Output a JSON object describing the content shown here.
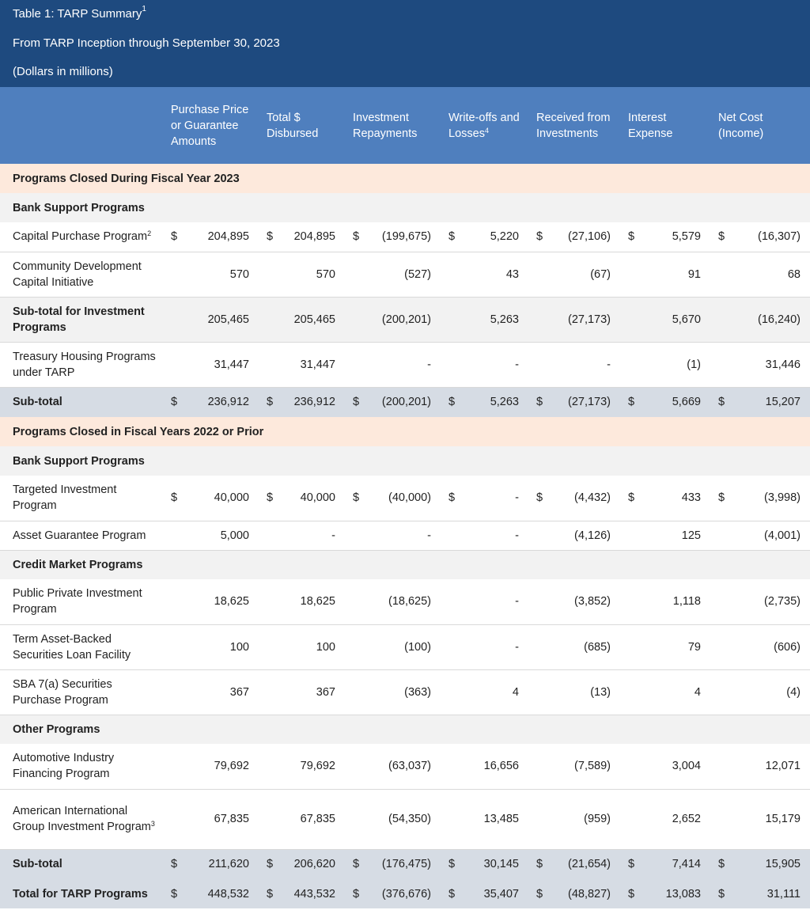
{
  "title": {
    "line1": "Table 1: TARP Summary",
    "line1_sup": "1",
    "line2": "From TARP Inception through September 30, 2023",
    "line3": "(Dollars in millions)"
  },
  "columns": [
    {
      "label": "Purchase Price or Guarantee Amounts",
      "sup": ""
    },
    {
      "label": "Total $ Disbursed",
      "sup": ""
    },
    {
      "label": "Investment Repayments",
      "sup": ""
    },
    {
      "label": "Write-offs and Losses",
      "sup": "4"
    },
    {
      "label": "Received from Investments",
      "sup": ""
    },
    {
      "label": "Interest Expense",
      "sup": ""
    },
    {
      "label": "Net Cost (Income)",
      "sup": ""
    }
  ],
  "rows": [
    {
      "type": "section",
      "label": "Programs Closed During Fiscal Year 2023"
    },
    {
      "type": "group",
      "label": "Bank Support Programs"
    },
    {
      "type": "data",
      "label": "Capital Purchase Program",
      "sup": "2",
      "dollar": true,
      "values": [
        "204,895",
        "204,895",
        "(199,675)",
        "5,220",
        "(27,106)",
        "5,579",
        "(16,307)"
      ]
    },
    {
      "type": "data",
      "label": "Community Development Capital Initiative",
      "sup": "",
      "dollar": false,
      "values": [
        "570",
        "570",
        "(527)",
        "43",
        "(67)",
        "91",
        "68"
      ]
    },
    {
      "type": "subinv",
      "label": "Sub-total for Investment Programs",
      "sup": "",
      "dollar": false,
      "values": [
        "205,465",
        "205,465",
        "(200,201)",
        "5,263",
        "(27,173)",
        "5,670",
        "(16,240)"
      ]
    },
    {
      "type": "data",
      "label": "Treasury Housing Programs under TARP",
      "sup": "",
      "dollar": false,
      "values": [
        "31,447",
        "31,447",
        "-",
        "-",
        "-",
        "(1)",
        "31,446"
      ]
    },
    {
      "type": "subtotal",
      "label": "Sub-total",
      "sup": "",
      "dollar": true,
      "values": [
        "236,912",
        "236,912",
        "(200,201)",
        "5,263",
        "(27,173)",
        "5,669",
        "15,207"
      ]
    },
    {
      "type": "section",
      "label": "Programs Closed in Fiscal Years 2022 or Prior"
    },
    {
      "type": "group",
      "label": "Bank Support Programs"
    },
    {
      "type": "data",
      "label": "Targeted Investment Program",
      "sup": "",
      "dollar": true,
      "values": [
        "40,000",
        "40,000",
        "(40,000)",
        "-",
        "(4,432)",
        "433",
        "(3,998)"
      ]
    },
    {
      "type": "data",
      "label": "Asset Guarantee Program",
      "sup": "",
      "dollar": false,
      "values": [
        "5,000",
        "-",
        "-",
        "-",
        "(4,126)",
        "125",
        "(4,001)"
      ]
    },
    {
      "type": "group",
      "label": "Credit Market Programs"
    },
    {
      "type": "data",
      "label": "Public Private Investment Program",
      "sup": "",
      "dollar": false,
      "values": [
        "18,625",
        "18,625",
        "(18,625)",
        "-",
        "(3,852)",
        "1,118",
        "(2,735)"
      ]
    },
    {
      "type": "data",
      "label": "Term Asset-Backed Securities Loan Facility",
      "sup": "",
      "dollar": false,
      "values": [
        "100",
        "100",
        "(100)",
        "-",
        "(685)",
        "79",
        "(606)"
      ]
    },
    {
      "type": "data",
      "label": "SBA 7(a) Securities Purchase Program",
      "sup": "",
      "dollar": false,
      "values": [
        "367",
        "367",
        "(363)",
        "4",
        "(13)",
        "4",
        "(4)"
      ]
    },
    {
      "type": "group",
      "label": "Other Programs"
    },
    {
      "type": "data",
      "label": "Automotive Industry Financing Program",
      "sup": "",
      "dollar": false,
      "values": [
        "79,692",
        "79,692",
        "(63,037)",
        "16,656",
        "(7,589)",
        "3,004",
        "12,071"
      ]
    },
    {
      "type": "data",
      "label": "American International Group Investment Program",
      "sup": "3",
      "dollar": false,
      "values": [
        "67,835",
        "67,835",
        "(54,350)",
        "13,485",
        "(959)",
        "2,652",
        "15,179"
      ]
    },
    {
      "type": "subtotal",
      "label": "Sub-total",
      "sup": "",
      "dollar": true,
      "values": [
        "211,620",
        "206,620",
        "(176,475)",
        "30,145",
        "(21,654)",
        "7,414",
        "15,905"
      ]
    },
    {
      "type": "total",
      "label": "Total for TARP Programs",
      "sup": "",
      "dollar": true,
      "values": [
        "448,532",
        "443,532",
        "(376,676)",
        "35,407",
        "(48,827)",
        "13,083",
        "31,111"
      ]
    }
  ],
  "currency_symbol": "$"
}
